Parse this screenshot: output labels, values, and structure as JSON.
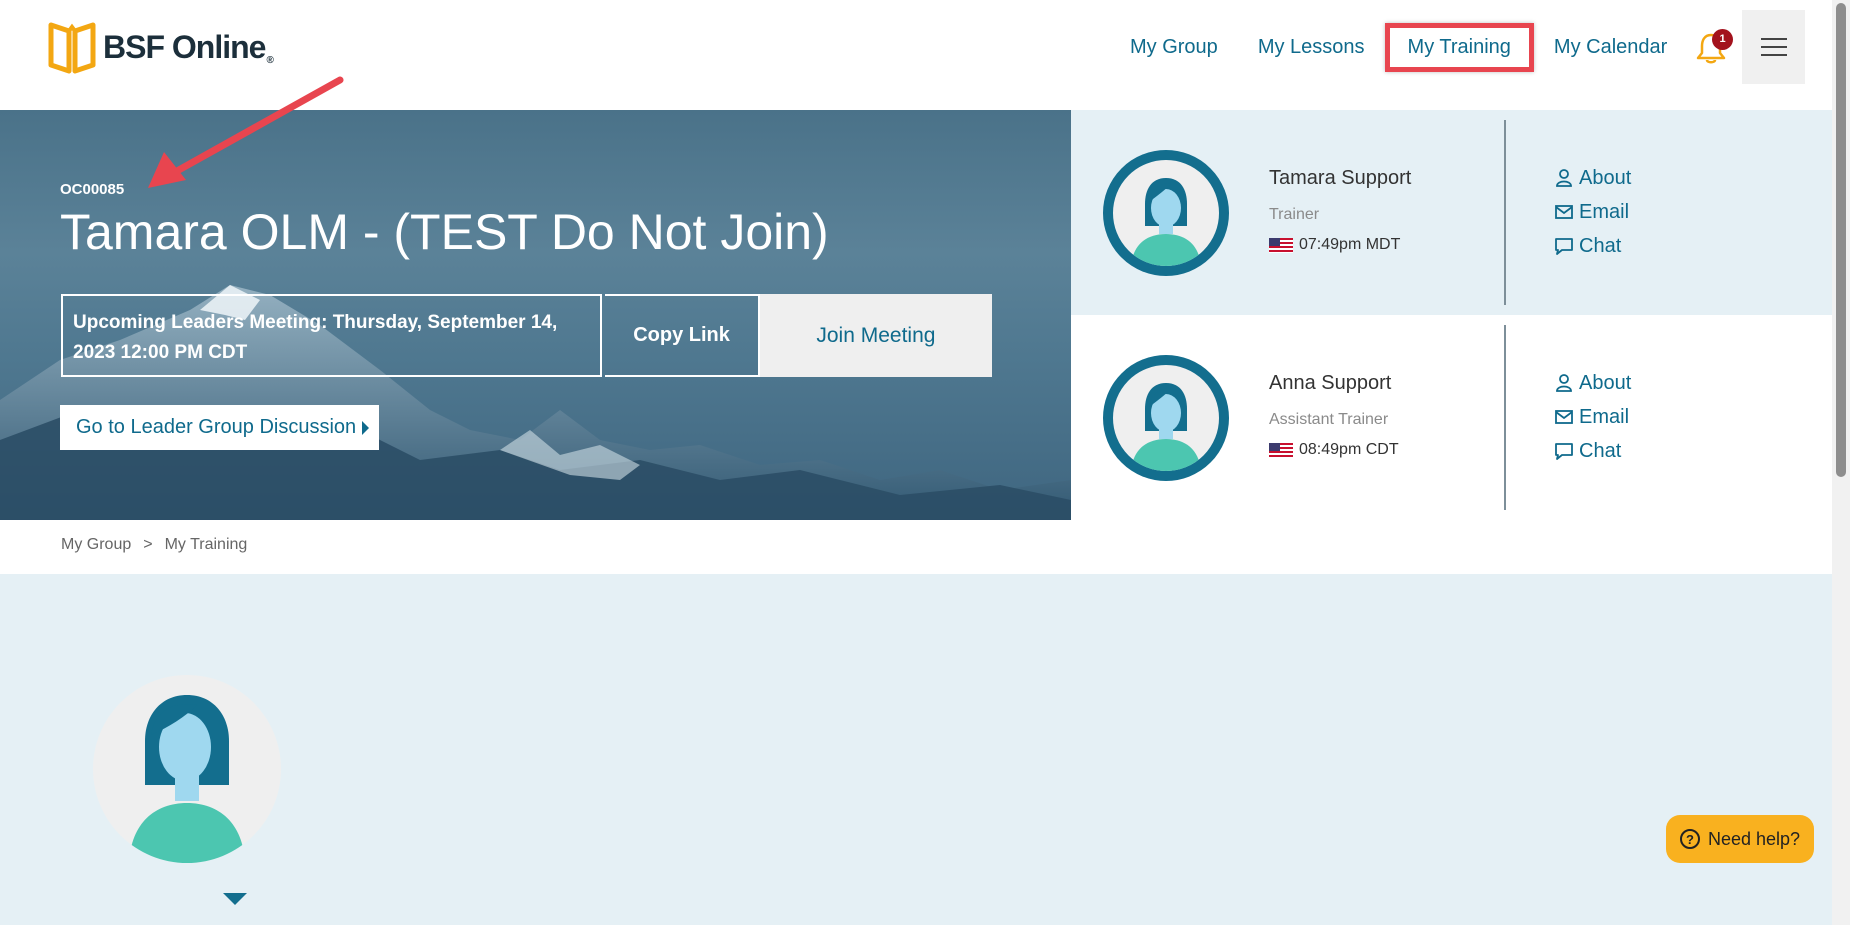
{
  "header": {
    "logo_text": "BSF Online",
    "logo_reg": "®",
    "nav": [
      {
        "label": "My Group"
      },
      {
        "label": "My Lessons"
      },
      {
        "label": "My Training",
        "active": true
      },
      {
        "label": "My Calendar"
      }
    ],
    "notification_count": "1",
    "icons": {
      "bell": "bell-icon",
      "menu": "hamburger-icon"
    }
  },
  "hero": {
    "code": "OC00085",
    "title": "Tamara OLM - (TEST Do Not Join)",
    "meeting_text": "Upcoming Leaders Meeting: Thursday, September 14, 2023 12:00 PM CDT",
    "copy_link_label": "Copy Link",
    "join_meeting_label": "Join Meeting",
    "discussion_label": "Go to Leader Group Discussion"
  },
  "trainers": [
    {
      "name": "Tamara Support",
      "role": "Trainer",
      "time": "07:49pm MDT",
      "links": {
        "about": "About",
        "email": "Email",
        "chat": "Chat"
      }
    },
    {
      "name": "Anna Support",
      "role": "Assistant Trainer",
      "time": "08:49pm CDT",
      "links": {
        "about": "About",
        "email": "Email",
        "chat": "Chat"
      }
    }
  ],
  "breadcrumb": {
    "items": [
      "My Group",
      "My Training"
    ],
    "separator": ">"
  },
  "help": {
    "label": "Need help?"
  },
  "colors": {
    "accent": "#0f6a8c",
    "avatar_ring": "#136e8e",
    "panel_bg": "#e5f0f5",
    "help_bg": "#f9b11f",
    "badge": "#a3121d",
    "annotation": "#e8454f"
  }
}
